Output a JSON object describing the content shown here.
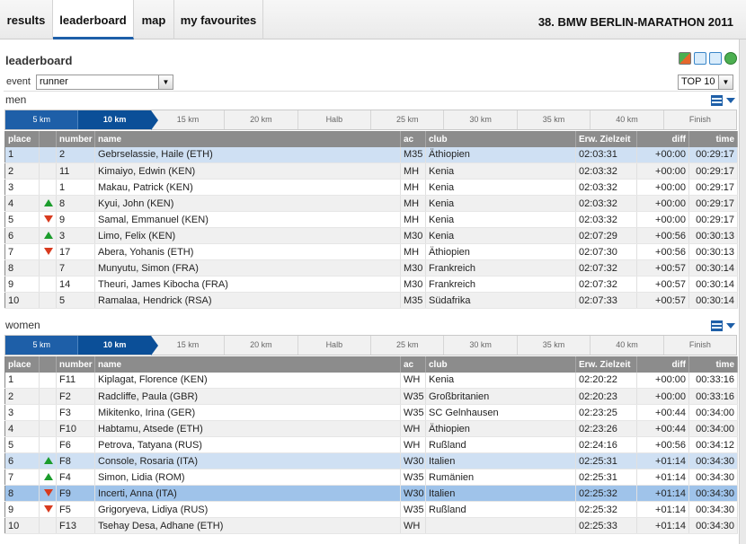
{
  "nav": {
    "tabs": [
      {
        "label": "results"
      },
      {
        "label": "leaderboard"
      },
      {
        "label": "map"
      },
      {
        "label": "my favourites"
      }
    ],
    "active_tab": "leaderboard",
    "event_title": "38. BMW BERLIN-MARATHON 2011"
  },
  "section_title": "leaderboard",
  "filters": {
    "event_label": "event",
    "event_value": "runner",
    "top_value": "TOP 10"
  },
  "splits": [
    "5 km",
    "10 km",
    "15 km",
    "20 km",
    "Halb",
    "25 km",
    "30 km",
    "35 km",
    "40 km",
    "Finish"
  ],
  "current_split": "10 km",
  "columns": {
    "place": "place",
    "trend": "",
    "number": "number",
    "name": "name",
    "ac": "ac",
    "club": "club",
    "zielzeit": "Erw. Zielzeit",
    "diff": "diff",
    "time": "time"
  },
  "men": {
    "title": "men",
    "rows": [
      {
        "place": "1",
        "trend": "",
        "number": "2",
        "name": "Gebrselassie, Haile (ETH)",
        "ac": "M35",
        "club": "Äthiopien",
        "zielzeit": "02:03:31",
        "diff": "+00:00",
        "time": "00:29:17",
        "style": "hl"
      },
      {
        "place": "2",
        "trend": "",
        "number": "11",
        "name": "Kimaiyo, Edwin (KEN)",
        "ac": "MH",
        "club": "Kenia",
        "zielzeit": "02:03:32",
        "diff": "+00:00",
        "time": "00:29:17",
        "style": "even"
      },
      {
        "place": "3",
        "trend": "",
        "number": "1",
        "name": "Makau, Patrick (KEN)",
        "ac": "MH",
        "club": "Kenia",
        "zielzeit": "02:03:32",
        "diff": "+00:00",
        "time": "00:29:17",
        "style": "odd"
      },
      {
        "place": "4",
        "trend": "up",
        "number": "8",
        "name": "Kyui, John (KEN)",
        "ac": "MH",
        "club": "Kenia",
        "zielzeit": "02:03:32",
        "diff": "+00:00",
        "time": "00:29:17",
        "style": "even"
      },
      {
        "place": "5",
        "trend": "down",
        "number": "9",
        "name": "Samal, Emmanuel (KEN)",
        "ac": "MH",
        "club": "Kenia",
        "zielzeit": "02:03:32",
        "diff": "+00:00",
        "time": "00:29:17",
        "style": "odd"
      },
      {
        "place": "6",
        "trend": "up",
        "number": "3",
        "name": "Limo, Felix (KEN)",
        "ac": "M30",
        "club": "Kenia",
        "zielzeit": "02:07:29",
        "diff": "+00:56",
        "time": "00:30:13",
        "style": "even"
      },
      {
        "place": "7",
        "trend": "down",
        "number": "17",
        "name": "Abera, Yohanis (ETH)",
        "ac": "MH",
        "club": "Äthiopien",
        "zielzeit": "02:07:30",
        "diff": "+00:56",
        "time": "00:30:13",
        "style": "odd"
      },
      {
        "place": "8",
        "trend": "",
        "number": "7",
        "name": "Munyutu, Simon (FRA)",
        "ac": "M30",
        "club": "Frankreich",
        "zielzeit": "02:07:32",
        "diff": "+00:57",
        "time": "00:30:14",
        "style": "even"
      },
      {
        "place": "9",
        "trend": "",
        "number": "14",
        "name": "Theuri, James Kibocha (FRA)",
        "ac": "M30",
        "club": "Frankreich",
        "zielzeit": "02:07:32",
        "diff": "+00:57",
        "time": "00:30:14",
        "style": "odd"
      },
      {
        "place": "10",
        "trend": "",
        "number": "5",
        "name": "Ramalaa, Hendrick (RSA)",
        "ac": "M35",
        "club": "Südafrika",
        "zielzeit": "02:07:33",
        "diff": "+00:57",
        "time": "00:30:14",
        "style": "even"
      }
    ]
  },
  "women": {
    "title": "women",
    "rows": [
      {
        "place": "1",
        "trend": "",
        "number": "F11",
        "name": "Kiplagat, Florence (KEN)",
        "ac": "WH",
        "club": "Kenia",
        "zielzeit": "02:20:22",
        "diff": "+00:00",
        "time": "00:33:16",
        "style": "odd"
      },
      {
        "place": "2",
        "trend": "",
        "number": "F2",
        "name": "Radcliffe, Paula (GBR)",
        "ac": "W35",
        "club": "Großbritanien",
        "zielzeit": "02:20:23",
        "diff": "+00:00",
        "time": "00:33:16",
        "style": "even"
      },
      {
        "place": "3",
        "trend": "",
        "number": "F3",
        "name": "Mikitenko, Irina (GER)",
        "ac": "W35",
        "club": "SC Gelnhausen",
        "zielzeit": "02:23:25",
        "diff": "+00:44",
        "time": "00:34:00",
        "style": "odd"
      },
      {
        "place": "4",
        "trend": "",
        "number": "F10",
        "name": "Habtamu, Atsede (ETH)",
        "ac": "WH",
        "club": "Äthiopien",
        "zielzeit": "02:23:26",
        "diff": "+00:44",
        "time": "00:34:00",
        "style": "even"
      },
      {
        "place": "5",
        "trend": "",
        "number": "F6",
        "name": "Petrova, Tatyana (RUS)",
        "ac": "WH",
        "club": "Rußland",
        "zielzeit": "02:24:16",
        "diff": "+00:56",
        "time": "00:34:12",
        "style": "odd"
      },
      {
        "place": "6",
        "trend": "up",
        "number": "F8",
        "name": "Console, Rosaria (ITA)",
        "ac": "W30",
        "club": "Italien",
        "zielzeit": "02:25:31",
        "diff": "+01:14",
        "time": "00:34:30",
        "style": "hl"
      },
      {
        "place": "7",
        "trend": "up",
        "number": "F4",
        "name": "Simon, Lidia (ROM)",
        "ac": "W35",
        "club": "Rumänien",
        "zielzeit": "02:25:31",
        "diff": "+01:14",
        "time": "00:34:30",
        "style": "odd"
      },
      {
        "place": "8",
        "trend": "down",
        "number": "F9",
        "name": "Incerti, Anna (ITA)",
        "ac": "W30",
        "club": "Italien",
        "zielzeit": "02:25:32",
        "diff": "+01:14",
        "time": "00:34:30",
        "style": "sel"
      },
      {
        "place": "9",
        "trend": "down",
        "number": "F5",
        "name": "Grigoryeva, Lidiya (RUS)",
        "ac": "W35",
        "club": "Rußland",
        "zielzeit": "02:25:32",
        "diff": "+01:14",
        "time": "00:34:30",
        "style": "odd"
      },
      {
        "place": "10",
        "trend": "",
        "number": "F13",
        "name": "Tsehay Desa, Adhane (ETH)",
        "ac": "WH",
        "club": "",
        "zielzeit": "02:25:33",
        "diff": "+01:14",
        "time": "00:34:30",
        "style": "even"
      }
    ]
  },
  "icons": [
    "people-icon",
    "list-view-icon",
    "columns-view-icon",
    "refresh-icon",
    "group-settings-icon",
    "collapse-icon"
  ],
  "colors": {
    "accent": "#1e5fa8",
    "up": "#1b9c2c",
    "down": "#d83a1e",
    "header": "#8c8c8c"
  }
}
